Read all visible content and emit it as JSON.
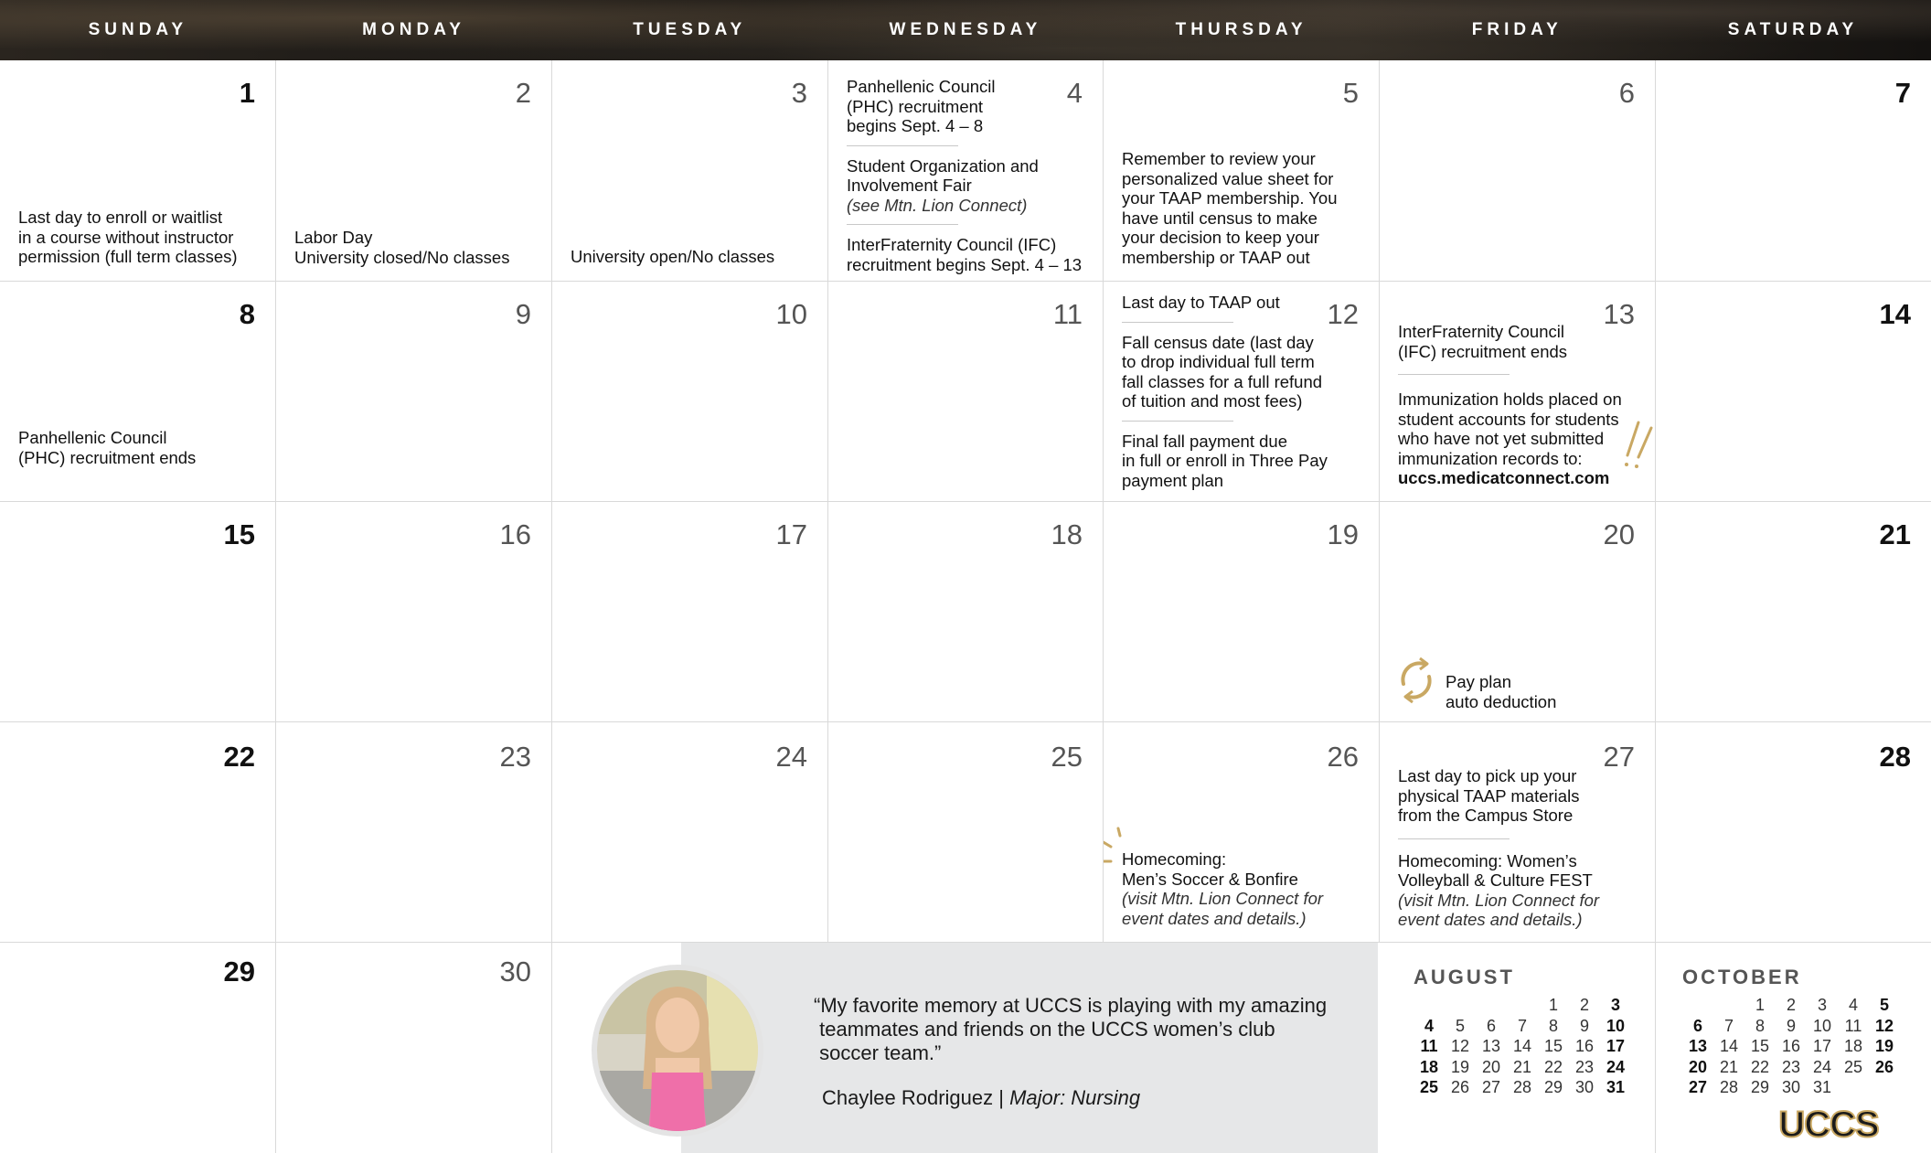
{
  "weekdays": [
    "SUNDAY",
    "MONDAY",
    "TUESDAY",
    "WEDNESDAY",
    "THURSDAY",
    "FRIDAY",
    "SATURDAY"
  ],
  "days": {
    "d1": "1",
    "d2": "2",
    "d3": "3",
    "d4": "4",
    "d5": "5",
    "d6": "6",
    "d7": "7",
    "d8": "8",
    "d9": "9",
    "d10": "10",
    "d11": "11",
    "d12": "12",
    "d13": "13",
    "d14": "14",
    "d15": "15",
    "d16": "16",
    "d17": "17",
    "d18": "18",
    "d19": "19",
    "d20": "20",
    "d21": "21",
    "d22": "22",
    "d23": "23",
    "d24": "24",
    "d25": "25",
    "d26": "26",
    "d27": "27",
    "d28": "28",
    "d29": "29",
    "d30": "30"
  },
  "events": {
    "d1": [
      "Last day to enroll or waitlist",
      "in a course without instructor",
      "permission (full term classes)"
    ],
    "d2": [
      "Labor Day",
      "University closed/No classes"
    ],
    "d3": [
      "University open/No classes"
    ],
    "d4_a": [
      "Panhellenic Council",
      "(PHC) recruitment",
      "begins Sept. 4 – 8"
    ],
    "d4_b": [
      "Student Organization and",
      "Involvement Fair"
    ],
    "d4_b_note": "(see Mtn. Lion Connect)",
    "d4_c": [
      "InterFraternity Council (IFC)",
      "recruitment begins Sept. 4 – 13"
    ],
    "d5": [
      "Remember to review your",
      "personalized value sheet for",
      "your TAAP membership. You",
      "have until census to make",
      "your decision to keep your",
      "membership or TAAP out"
    ],
    "d8": [
      "Panhellenic Council",
      "(PHC) recruitment ends"
    ],
    "d12_a": [
      "Last day to TAAP out"
    ],
    "d12_b": [
      "Fall census date (last day",
      "to drop individual full term",
      "fall classes for a full refund",
      "of tuition and most fees)"
    ],
    "d12_c": [
      "Final fall payment due",
      "in full or enroll in Three Pay",
      "payment plan"
    ],
    "d13_a": [
      "InterFraternity Council",
      "(IFC) recruitment ends"
    ],
    "d13_b": [
      "Immunization holds placed on",
      "student accounts for students",
      "who have not yet submitted",
      "immunization records to:"
    ],
    "d13_link": "uccs.medicatconnect.com",
    "d20": [
      "Pay plan",
      "auto deduction"
    ],
    "d26": [
      "Homecoming:",
      "Men’s Soccer & Bonfire"
    ],
    "d26_note": [
      "(visit Mtn. Lion Connect for",
      "event dates and details.)"
    ],
    "d27_a": [
      "Last day to pick up your",
      "physical TAAP materials",
      "from the Campus Store"
    ],
    "d27_b": [
      "Homecoming: Women’s",
      "Volleyball & Culture FEST"
    ],
    "d27_note": [
      "(visit Mtn. Lion Connect for",
      "event dates and details.)"
    ]
  },
  "quote": {
    "text_lines": [
      "“My favorite memory at UCCS is playing with my amazing",
      " teammates and friends on the UCCS women’s club",
      " soccer team.”"
    ],
    "name": "Chaylee Rodriguez",
    "separator": " | ",
    "major": "Major: Nursing"
  },
  "mini_calendars": [
    {
      "title": "AUGUST",
      "weeks": [
        [
          "",
          "",
          "",
          "",
          "1",
          "2",
          "3"
        ],
        [
          "4",
          "5",
          "6",
          "7",
          "8",
          "9",
          "10"
        ],
        [
          "11",
          "12",
          "13",
          "14",
          "15",
          "16",
          "17"
        ],
        [
          "18",
          "19",
          "20",
          "21",
          "22",
          "23",
          "24"
        ],
        [
          "25",
          "26",
          "27",
          "28",
          "29",
          "30",
          "31"
        ]
      ]
    },
    {
      "title": "OCTOBER",
      "weeks": [
        [
          "",
          "",
          "1",
          "2",
          "3",
          "4",
          "5"
        ],
        [
          "6",
          "7",
          "8",
          "9",
          "10",
          "11",
          "12"
        ],
        [
          "13",
          "14",
          "15",
          "16",
          "17",
          "18",
          "19"
        ],
        [
          "20",
          "21",
          "22",
          "23",
          "24",
          "25",
          "26"
        ],
        [
          "27",
          "28",
          "29",
          "30",
          "31",
          "",
          ""
        ]
      ]
    }
  ],
  "logo_text": "UCCS",
  "colors": {
    "gold": "#c9a863",
    "header_bg": "#1c1a17",
    "quote_bg": "#e6e7e8",
    "grid_line": "#d9d9d9"
  }
}
